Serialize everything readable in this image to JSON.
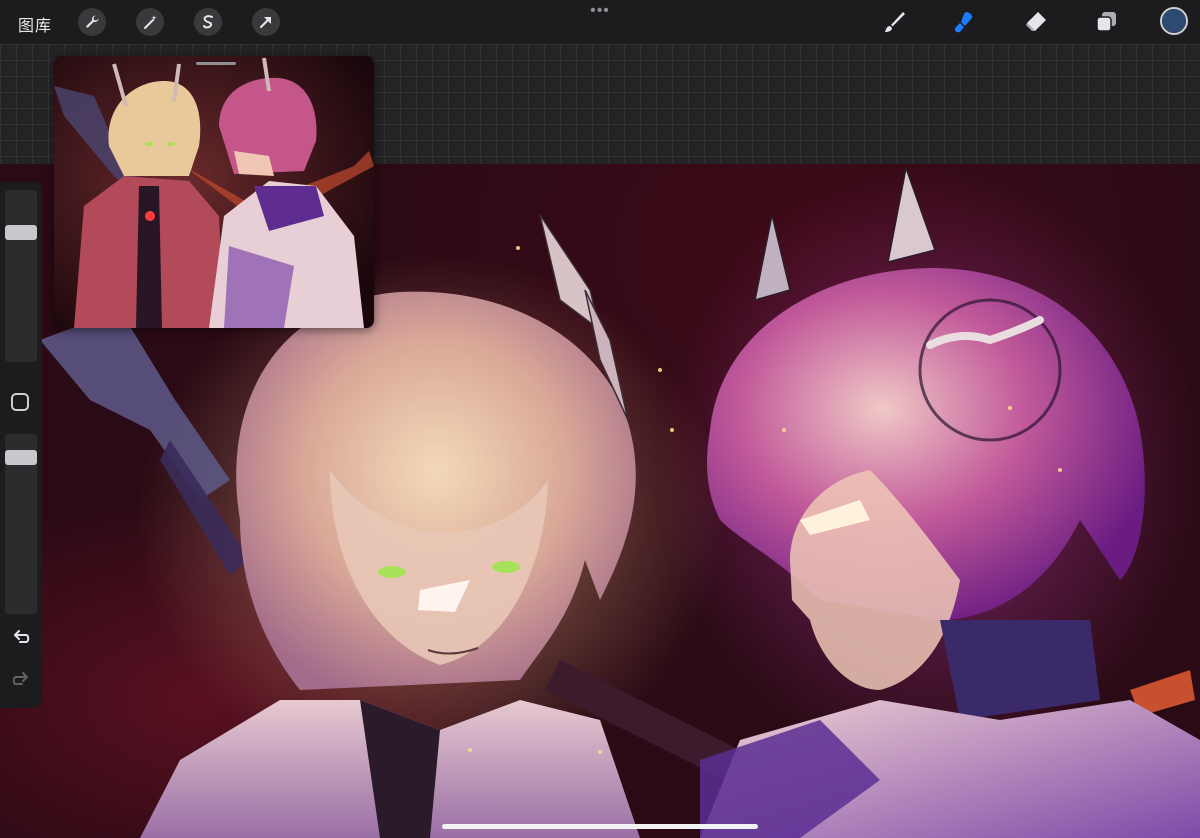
{
  "toolbar": {
    "gallery_label": "图库",
    "left_tools": [
      "wrench-icon",
      "magic-wand-icon",
      "selection-icon",
      "transform-arrow-icon"
    ],
    "more_label": "•••",
    "right_tools": [
      "brush-icon",
      "smudge-icon",
      "eraser-icon",
      "layers-icon"
    ],
    "active_tool": "smudge-icon",
    "active_color": "#2f4a72",
    "accent_color": "#1a7cff"
  },
  "sidebar": {
    "brush_size_level": 0.78,
    "opacity_level": 0.9,
    "buttons": [
      "modify-button",
      "undo-button",
      "redo-button"
    ]
  },
  "reference": {
    "visible": true
  }
}
